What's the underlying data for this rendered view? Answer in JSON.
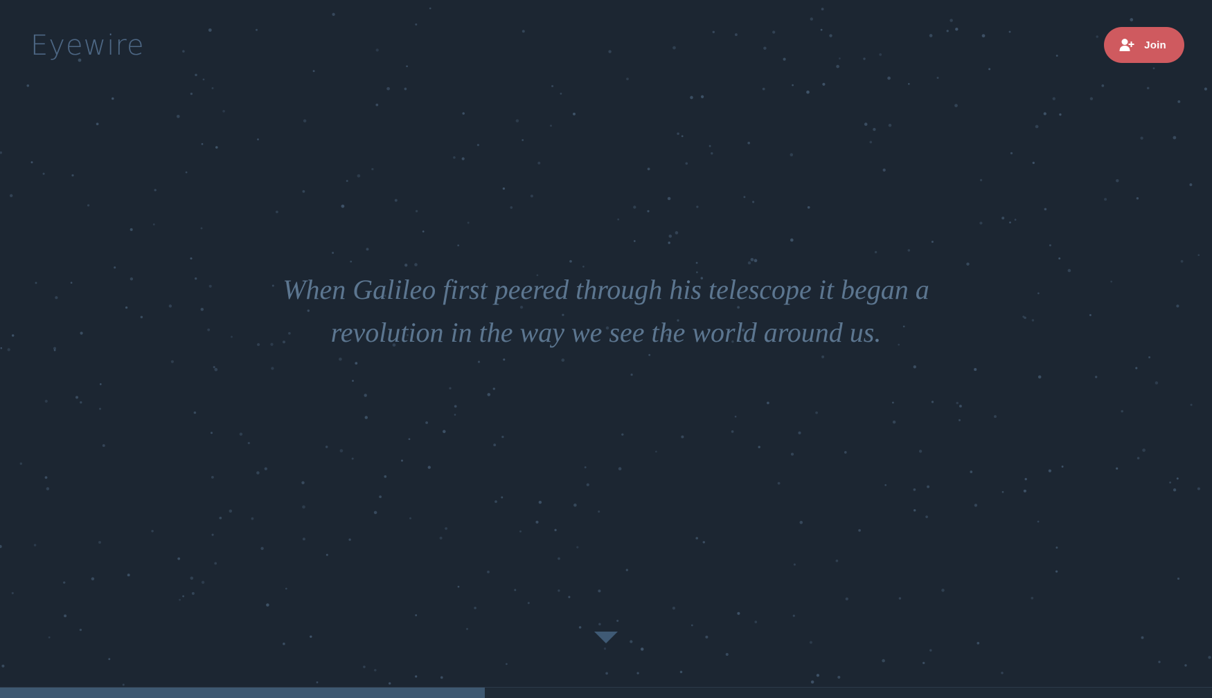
{
  "header": {
    "logo_text": "Eyewire",
    "join_button": {
      "label": "Join",
      "icon": "user-plus-icon"
    }
  },
  "hero": {
    "quote_line1": "When Galileo first peered through his telescope it began a",
    "quote_line2": "revolution in the way we see the world around us."
  },
  "scroll_indicator": {
    "icon": "caret-down-icon"
  },
  "progress": {
    "fraction": 0.4
  },
  "colors": {
    "background": "#1c2632",
    "logo": "#4d6784",
    "quote": "#5c7690",
    "join_button": "#cf5a5f",
    "progress_fill": "#3e5871",
    "stars": "#3f5368"
  }
}
